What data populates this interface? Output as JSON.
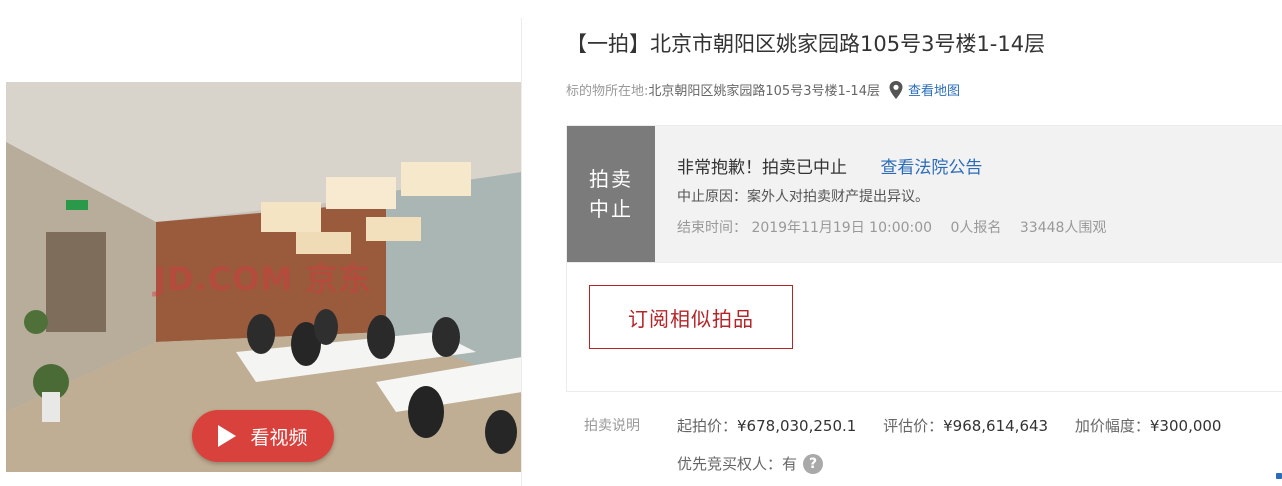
{
  "media": {
    "watermark": "JD.COM 京东",
    "video_label": "看视频"
  },
  "auction": {
    "title": "【一拍】北京市朝阳区姚家园路105号3号楼1-14层",
    "location_label": "标的物所在地:",
    "location_value": "北京朝阳区姚家园路105号3号楼1-14层",
    "map_link": "查看地图",
    "status_line1": "拍卖",
    "status_line2": "中止",
    "message": "非常抱歉！拍卖已中止",
    "notice_link": "查看法院公告",
    "reason": "中止原因：案外人对拍卖财产提出异议。",
    "end_time_label": "结束时间：",
    "end_time": "2019年11月19日 10:00:00",
    "signups": "0人报名",
    "viewers": "33448人围观",
    "subscribe_label": "订阅相似拍品"
  },
  "explain": {
    "label": "拍卖说明",
    "start_price_label": "起拍价：",
    "start_price": "¥678,030,250.1",
    "appraisal_label": "评估价：",
    "appraisal": "¥968,614,643",
    "increment_label": "加价幅度：",
    "increment": "¥300,000",
    "priority_label": "优先竞买权人：",
    "priority_value": "有"
  },
  "colors": {
    "accent_red": "#b4252a",
    "link_blue": "#2b6cb8",
    "status_gray": "#7b7b7b",
    "video_button": "#d9413c"
  },
  "icons": [
    "play-icon",
    "map-pin-icon",
    "help-icon"
  ]
}
